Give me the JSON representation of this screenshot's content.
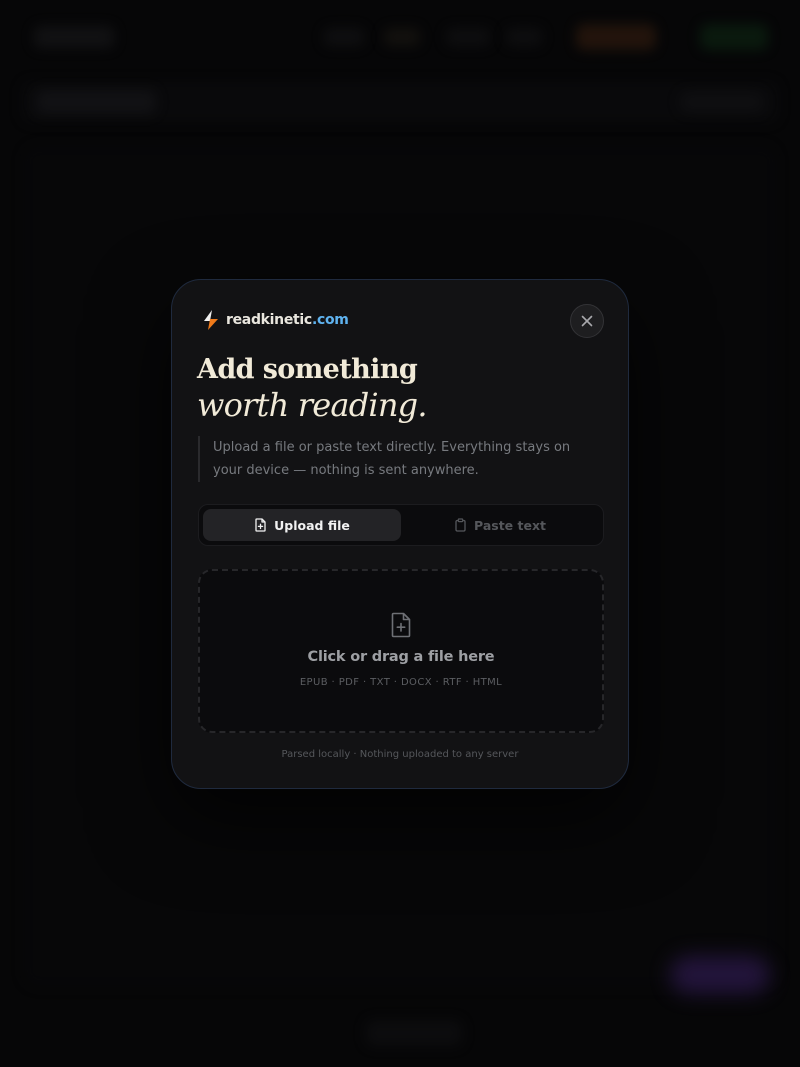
{
  "colors": {
    "backdrop": "#060607",
    "modal_bg": "#121214",
    "modal_border": "#1f2a3e",
    "title": "#f1ead8",
    "brand_name": "#e9e6de",
    "brand_tld": "#5fb3f0",
    "brand_icon_top": "#f0f0f0",
    "brand_icon_bottom": "#f07a1a",
    "active_tab_bg": "#232326",
    "muted_text": "#777a7f"
  },
  "modal": {
    "brand": {
      "icon": "lightning-bolt-icon",
      "name": "readkinetic",
      "tld": ".com"
    },
    "close": {
      "icon": "close-icon"
    },
    "title": {
      "line1": "Add something",
      "line2": "worth reading."
    },
    "description": "Upload a file or paste text directly. Everything stays on your device — nothing is sent anywhere.",
    "tabs": [
      {
        "label": "Upload file",
        "icon": "file-plus-icon",
        "active": true
      },
      {
        "label": "Paste text",
        "icon": "clipboard-icon",
        "active": false
      }
    ],
    "dropzone": {
      "icon": "file-plus-icon",
      "title": "Click or drag a file here",
      "formats": "EPUB · PDF · TXT · DOCX · RTF · HTML"
    },
    "footer_note": "Parsed locally · Nothing uploaded to any server"
  }
}
